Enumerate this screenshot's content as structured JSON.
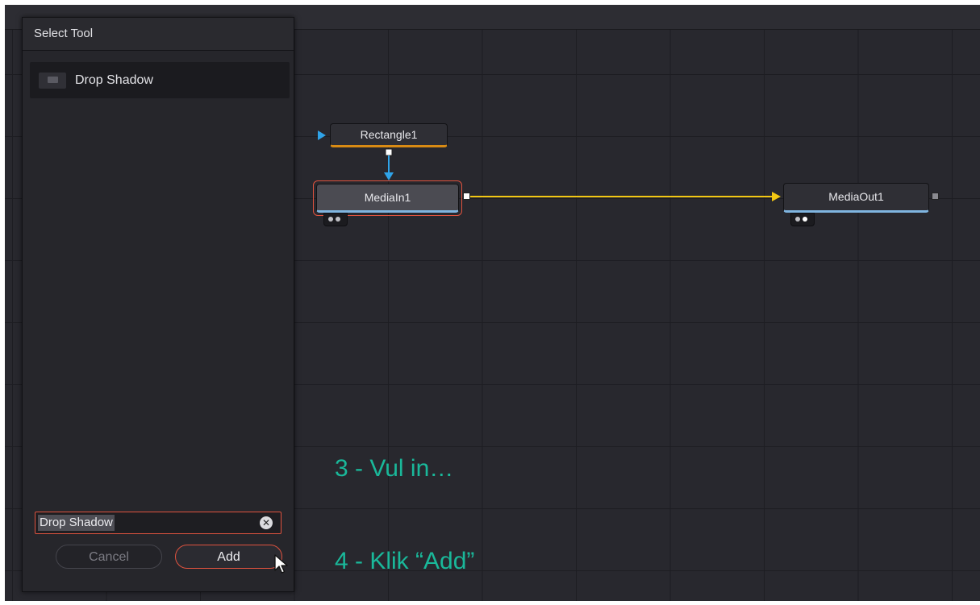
{
  "dialog": {
    "title": "Select Tool",
    "results": [
      {
        "label": "Drop Shadow",
        "icon": "tool-icon"
      }
    ],
    "search": {
      "value": "Drop Shadow"
    },
    "cancel_label": "Cancel",
    "add_label": "Add"
  },
  "nodes": {
    "rectangle": {
      "label": "Rectangle1"
    },
    "media_in": {
      "label": "MediaIn1"
    },
    "media_out": {
      "label": "MediaOut1"
    }
  },
  "annotations": {
    "step3": "3 - Vul in…",
    "step4": "4 - Klik “Add”"
  },
  "colors": {
    "accent_select": "#e0533f",
    "link_yellow": "#f2c713",
    "link_blue": "#2fa3e8",
    "rect_tab": "#d98b14",
    "annotation": "#1ab89a"
  }
}
